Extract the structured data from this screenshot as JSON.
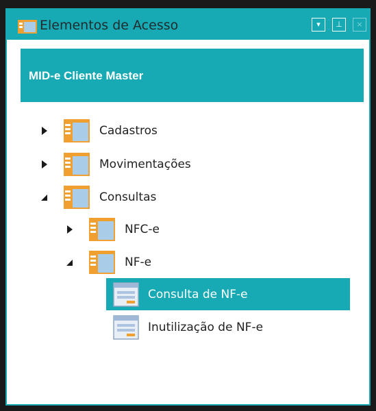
{
  "window": {
    "title": "Elementos de Acesso",
    "buttons": {
      "dropdown_glyph": "▾",
      "pin_glyph": "⊥",
      "close_glyph": "×"
    }
  },
  "header": {
    "title": "MID-e Cliente Master"
  },
  "tree": {
    "cadastros": {
      "label": "Cadastros",
      "expanded": false
    },
    "movimentacoes": {
      "label": "Movimentações",
      "expanded": false
    },
    "consultas": {
      "label": "Consultas",
      "expanded": true
    },
    "nfce": {
      "label": "NFC-e",
      "expanded": false
    },
    "nfe": {
      "label": "NF-e",
      "expanded": true
    },
    "consulta_nfe": {
      "label": "Consulta de NF-e",
      "selected": true
    },
    "inutilizacao_nfe": {
      "label": "Inutilização de NF-e",
      "selected": false
    }
  },
  "colors": {
    "accent": "#17aab4",
    "folder_orange": "#f0a030",
    "folder_blue": "#7ba9d8"
  }
}
